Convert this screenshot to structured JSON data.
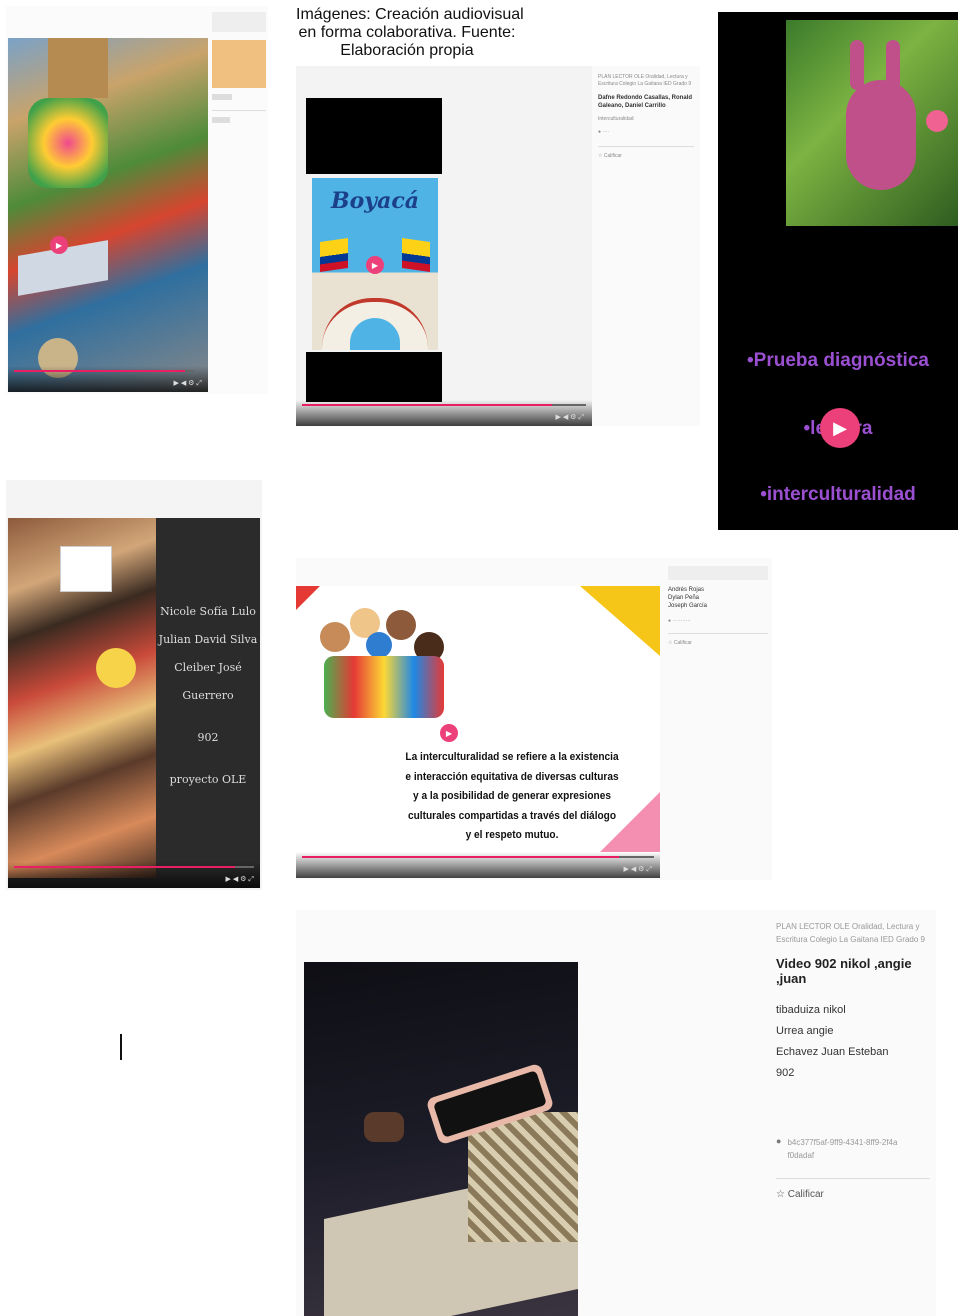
{
  "caption": {
    "line1": "Imágenes: Creación audiovisual",
    "line2": "en forma colaborativa.  Fuente:",
    "line3": "Elaboración propia"
  },
  "colors": {
    "accent": "#e91e63",
    "yellow": "#f5c518"
  },
  "card_boyaca": {
    "slide_title": "Boyacá",
    "course": "PLAN LECTOR OLE Oralidad, Lectura y Escritura Colegio La Gaitana IED Grado 9",
    "authors": "Dafne Redondo Casallas, Ronald Galeano, Daniel Carrillo",
    "topic": "Interculturalidad",
    "rate": "Calificar"
  },
  "card_diagnostic": {
    "line1": "•Prueba diagnóstica",
    "line2": "•lectura",
    "line3": "•interculturalidad"
  },
  "card_collage": {
    "names": [
      "Nicole Sofía Lulo",
      "Julian David Silva",
      "Cleiber José Guerrero"
    ],
    "grade": "902",
    "project": "proyecto OLE"
  },
  "card_intercultural": {
    "text": "La interculturalidad se refiere a la existencia e interacción equitativa de diversas culturas y a la posibilidad de generar expresiones culturales compartidas a través del diálogo y el respeto mutuo.",
    "authors": [
      "Andrés Rojas",
      "Dylan Peña",
      "Joseph García"
    ],
    "rate": "Calificar"
  },
  "card_video": {
    "course": "PLAN LECTOR OLE Oralidad, Lectura y Escritura Colegio La Gaitana IED Grado 9",
    "title": "Video 902 nikol ,angie ,juan",
    "members": [
      "tibaduiza nikol",
      "Urrea angie",
      "Echavez  Juan Esteban",
      "902"
    ],
    "id": "b4c377f5af-9ff9-4341-8ff9-2f4af0dadaf",
    "rate": "Calificar"
  }
}
